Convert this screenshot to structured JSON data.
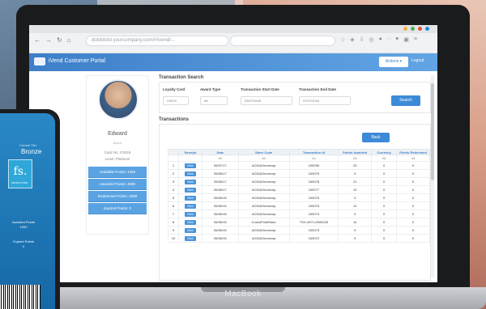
{
  "browser": {
    "url": "dotdotdot.yourcompany.com/#!ivend/...",
    "traffic_colors": [
      "#f3b13c",
      "#4caf50",
      "#e74c3c",
      "#1e88e5"
    ]
  },
  "app": {
    "title": "iVend Customer Portal",
    "actions_label": "Actions ▾",
    "logout_label": "Logout"
  },
  "profile": {
    "name": "Edward",
    "subtitle": "Active",
    "card_no": "Card No: C0019",
    "level": "Level: Platinum",
    "points": [
      "Available Points: 1492",
      "Awarded Points: 4000",
      "Redeemed Points: 2508",
      "Expired Points: 0"
    ]
  },
  "search": {
    "title": "Transaction Search",
    "fields": {
      "loyalty_card_label": "Loyalty Card",
      "loyalty_card_value": "C0019",
      "award_type_label": "Award Type",
      "award_type_value": "All",
      "start_label": "Transaction Start Date",
      "start_value": "03/27/2018",
      "end_label": "Transaction End Date",
      "end_value": "07/27/2018"
    },
    "button": "Search"
  },
  "transactions": {
    "title": "Transactions",
    "back": "Back",
    "headers": [
      "",
      "Receipt",
      "Date",
      "Store Code",
      "Transaction Id",
      "Points Awarded",
      "Currency",
      "Points Redeemed"
    ],
    "filters": [
      "",
      "",
      "All",
      "All",
      "All",
      "All",
      "All",
      "All"
    ],
    "rows": [
      [
        "1",
        "View",
        "05/07/17",
        "ACIDAOmnicorp",
        "100090",
        "20",
        "0",
        "0"
      ],
      [
        "2",
        "View",
        "05/06/17",
        "ACIDAOmnicorp",
        "100079",
        "0",
        "0",
        "0"
      ],
      [
        "3",
        "View",
        "05/06/17",
        "ACIDAOmnicorp",
        "100078",
        "21",
        "0",
        "0"
      ],
      [
        "4",
        "View",
        "05/06/17",
        "ACIDAOmnicorp",
        "100077",
        "10",
        "0",
        "0"
      ],
      [
        "5",
        "View",
        "05/06/15",
        "ACIDAOmnicorp",
        "100076",
        "0",
        "0",
        "0"
      ],
      [
        "6",
        "View",
        "05/06/15",
        "ACIDAOmnicorp",
        "100075",
        "12",
        "0",
        "0"
      ],
      [
        "7",
        "View",
        "05/06/15",
        "ACIDAOmnicorp",
        "100074",
        "0",
        "0",
        "0"
      ],
      [
        "8",
        "View",
        "05/06/15",
        "CrownPointStore",
        "TXX-4971-0000128",
        "14",
        "0",
        "0"
      ],
      [
        "9",
        "View",
        "05/06/15",
        "ACIDAOmnicorp",
        "100073",
        "0",
        "0",
        "0"
      ],
      [
        "10",
        "View",
        "05/06/15",
        "ACIDAOmnicorp",
        "100072",
        "0",
        "0",
        "0"
      ]
    ]
  },
  "device": {
    "laptop_brand": "MacBook"
  },
  "phone": {
    "tier_label": "Current Tier",
    "tier": "Bronze",
    "logo": "fs.",
    "logo_tag": "FASHION STORE",
    "awarded_label": "Awarded Points",
    "awarded_value": "1000",
    "expired_label": "Expired Points",
    "expired_value": "0"
  }
}
